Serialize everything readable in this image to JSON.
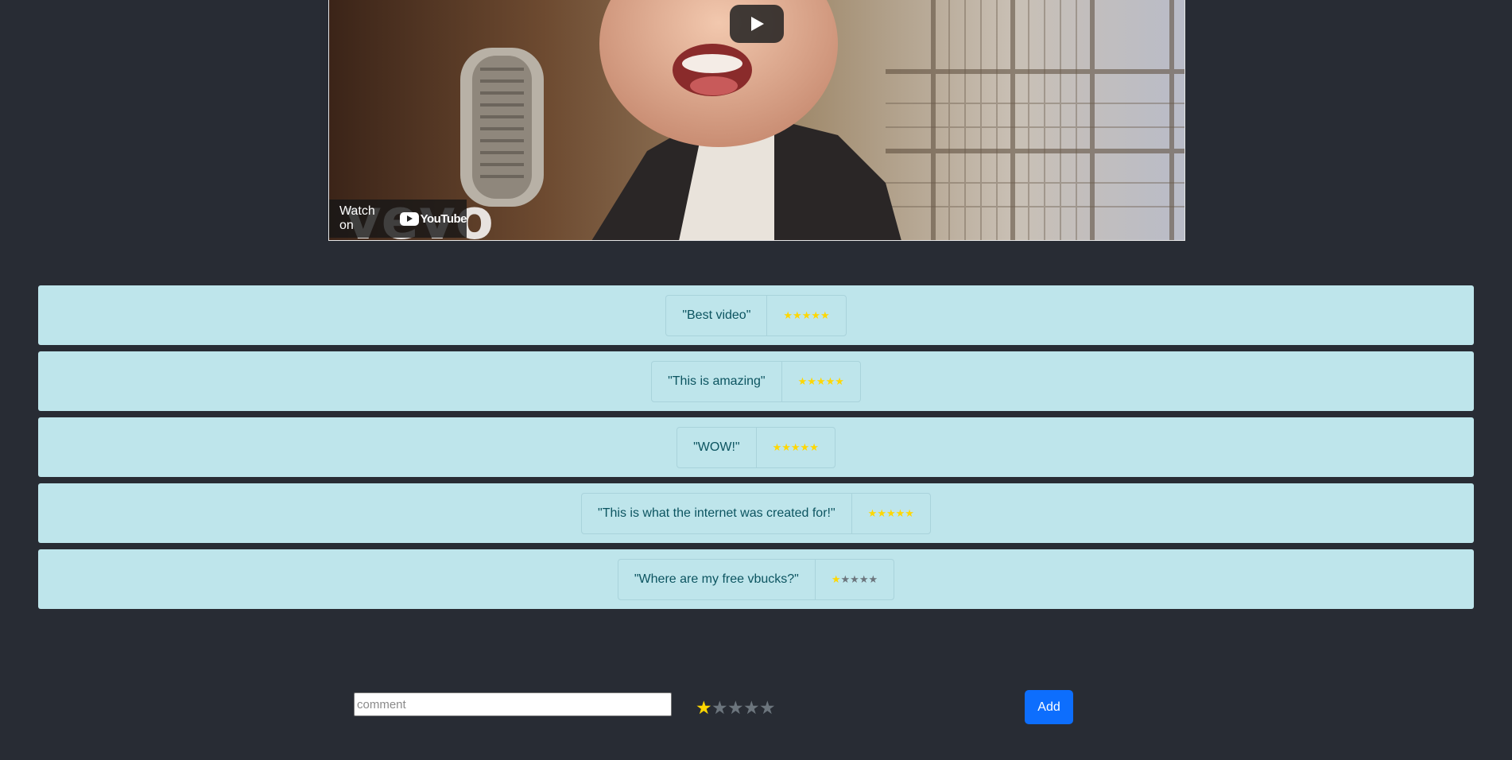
{
  "video": {
    "watch_on_label": "Watch on",
    "platform_name": "YouTube",
    "watermark": "vevo"
  },
  "reviews": [
    {
      "comment": "\"Best video\"",
      "rating": 5,
      "max": 5
    },
    {
      "comment": "\"This is amazing\"",
      "rating": 5,
      "max": 5
    },
    {
      "comment": "\"WOW!\"",
      "rating": 5,
      "max": 5
    },
    {
      "comment": "\"This is what the internet was created for!\"",
      "rating": 5,
      "max": 5
    },
    {
      "comment": "\"Where are my free vbucks?\"",
      "rating": 1,
      "max": 5
    }
  ],
  "add_form": {
    "comment_placeholder": "comment",
    "comment_value": "",
    "selected_rating": 1,
    "max_rating": 5,
    "add_label": "Add"
  },
  "colors": {
    "background": "#282c34",
    "review_bg": "#bee5eb",
    "review_text": "#0c5460",
    "star_filled": "#ffd700",
    "star_empty": "#6c757d",
    "button": "#0d6efd"
  }
}
